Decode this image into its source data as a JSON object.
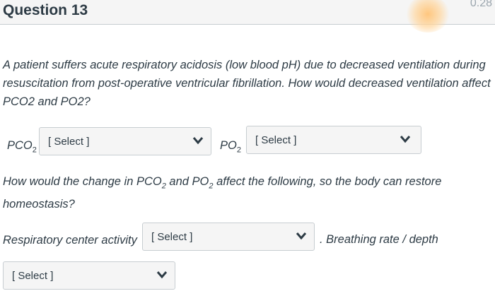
{
  "question": {
    "title": "Question 13",
    "points": "0.28"
  },
  "prompt1": "A patient suffers acute respiratory acidosis (low blood pH) due to decreased ventilation during resuscitation from post-operative ventricular fibrillation. How would decreased ventilation affect PCO2 and PO2?",
  "row1": {
    "pco2_label": "PCO",
    "pco2_sub": "2",
    "pco2_select": "[ Select ]",
    "po2_label": "PO",
    "po2_sub": "2",
    "po2_select": "[ Select ]"
  },
  "prompt2": {
    "part1": "How would the change in PCO",
    "sub1": "2",
    "part2": " and PO",
    "sub2": "2",
    "part3": " affect the following, so the body can restore homeostasis?"
  },
  "row2": {
    "resp_label": "Respiratory center activity",
    "resp_select": "[ Select ]",
    "breath_label": ". Breathing rate / depth"
  },
  "row3": {
    "select": "[ Select ]"
  },
  "icons": {
    "dropdown": "chevron-down-icon"
  }
}
